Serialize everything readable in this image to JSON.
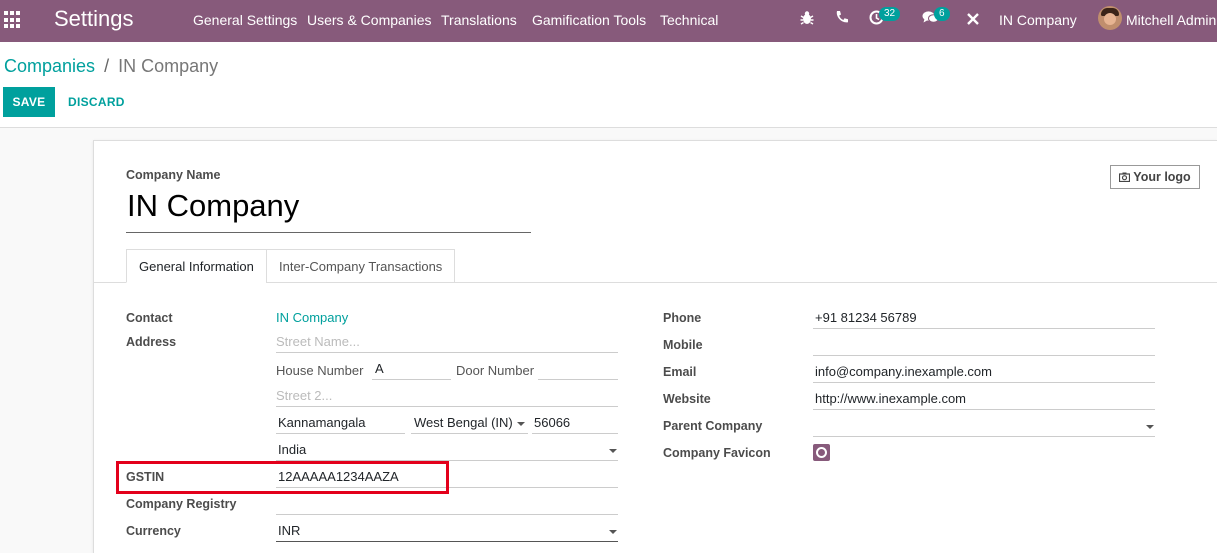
{
  "navbar": {
    "app_title": "Settings",
    "menu": [
      "General Settings",
      "Users & Companies",
      "Translations",
      "Gamification Tools",
      "Technical"
    ],
    "activity_count": "32",
    "messages_count": "6",
    "company": "IN Company",
    "user": "Mitchell Admin"
  },
  "breadcrumb": {
    "parent": "Companies",
    "separator": "/",
    "current": "IN Company"
  },
  "actions": {
    "save": "SAVE",
    "discard": "DISCARD"
  },
  "form": {
    "company_name_label": "Company Name",
    "company_name": "IN Company",
    "logo_button": "Your logo",
    "tabs": [
      "General Information",
      "Inter-Company Transactions"
    ],
    "left": {
      "contact_label": "Contact",
      "contact_value": "IN Company",
      "address_label": "Address",
      "street_placeholder": "Street Name...",
      "house_number_label": "House Number",
      "house_number": "A",
      "door_number_label": "Door Number",
      "door_number": "",
      "street2_placeholder": "Street 2...",
      "city": "Kannamangala",
      "state": "West Bengal (IN)",
      "zip": "56066",
      "country": "India",
      "gstin_label": "GSTIN",
      "gstin": "12AAAAA1234AAZA",
      "registry_label": "Company Registry",
      "registry": "",
      "currency_label": "Currency",
      "currency": "INR"
    },
    "right": {
      "phone_label": "Phone",
      "phone": "+91 81234 56789",
      "mobile_label": "Mobile",
      "mobile": "",
      "email_label": "Email",
      "email": "info@company.inexample.com",
      "website_label": "Website",
      "website": "http://www.inexample.com",
      "parent_label": "Parent Company",
      "parent": "",
      "favicon_label": "Company Favicon"
    }
  }
}
